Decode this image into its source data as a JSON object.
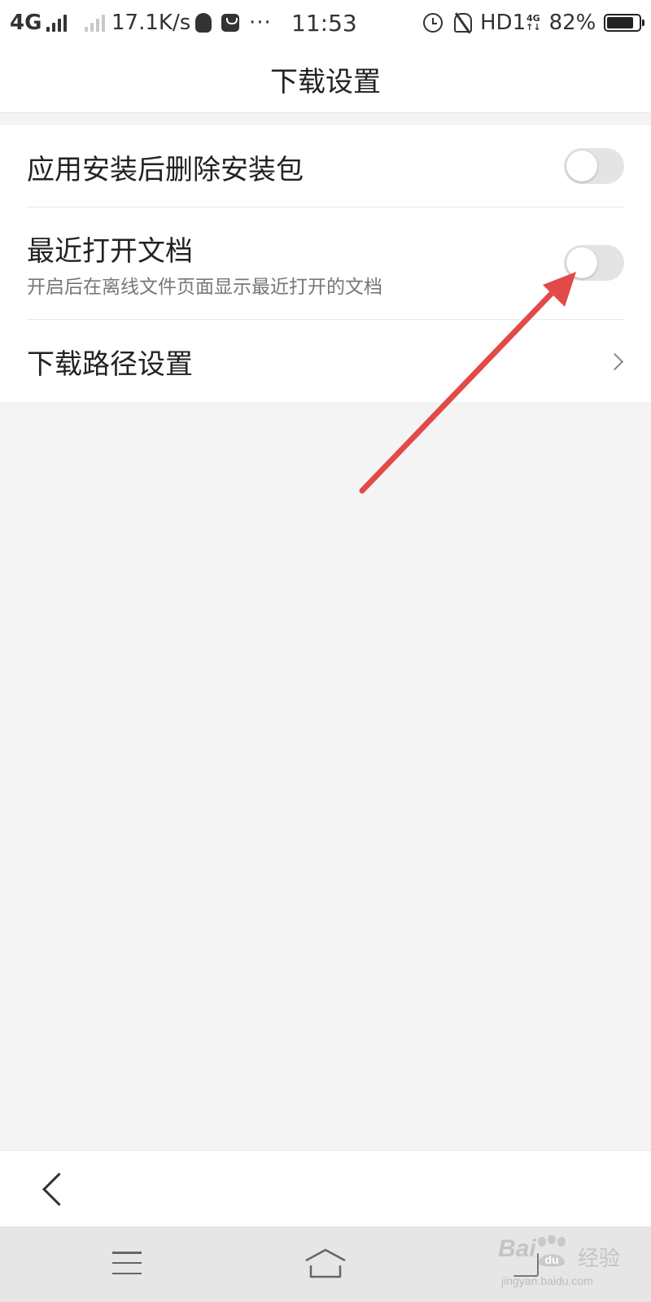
{
  "status_bar": {
    "network_primary": "4G",
    "net_speed": "17.1K/s",
    "more": "···",
    "time": "11:53",
    "hd_label": "HD1",
    "net_small_top": "4G",
    "net_small_bottom": "↑↓",
    "battery_percent": "82%",
    "battery_level": 0.82
  },
  "header": {
    "title": "下载设置"
  },
  "settings": {
    "items": [
      {
        "label": "应用安装后删除安装包",
        "toggle_on": false
      },
      {
        "label": "最近打开文档",
        "subtitle": "开启后在离线文件页面显示最近打开的文档",
        "toggle_on": false
      },
      {
        "label": "下载路径设置"
      }
    ]
  },
  "annotation": {
    "arrow_color": "#e24a4a"
  },
  "watermark": {
    "logo": "Bai",
    "logo_tail": "du",
    "label": "经验",
    "sub": "jingyan.baidu.com"
  },
  "colors": {
    "page_background": "#f4f4f4",
    "surface": "#ffffff",
    "toggle_off": "#e4e4e4",
    "nav_background": "#e6e6e6"
  }
}
